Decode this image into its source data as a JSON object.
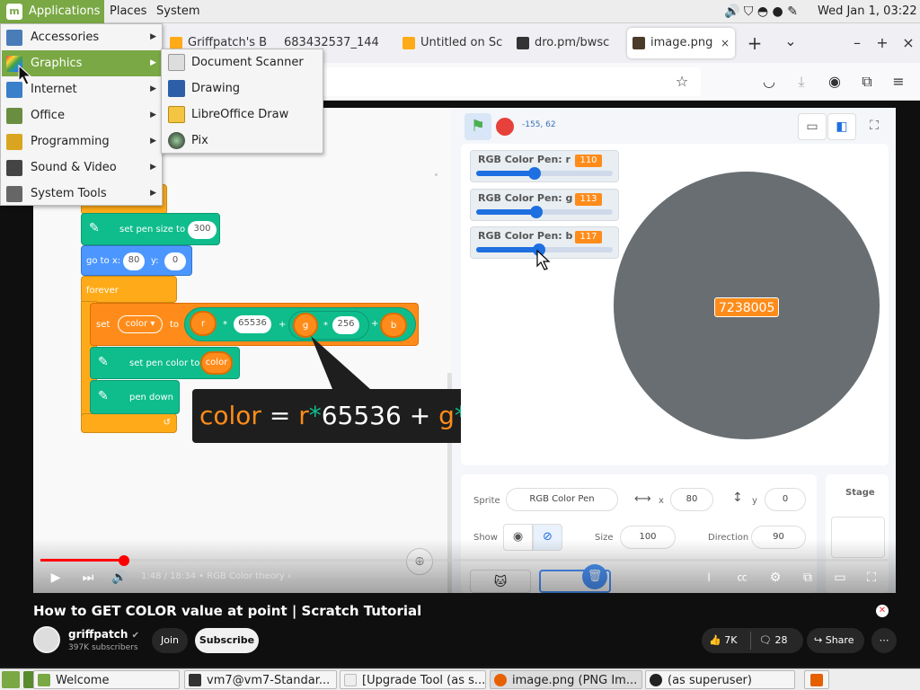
{
  "topbar": {
    "applications": "Applications",
    "places": "Places",
    "system": "System",
    "clock": "Wed Jan  1, 03:22"
  },
  "app_menu": {
    "items": [
      {
        "label": "Accessories",
        "icon": "accessories-icon",
        "color": "#4a7cb8"
      },
      {
        "label": "Graphics",
        "icon": "graphics-icon",
        "color": "#e05a2b",
        "highlighted": true
      },
      {
        "label": "Internet",
        "icon": "internet-icon",
        "color": "#3a7fc9"
      },
      {
        "label": "Office",
        "icon": "office-icon",
        "color": "#6a8e3f"
      },
      {
        "label": "Programming",
        "icon": "programming-icon",
        "color": "#d9a520"
      },
      {
        "label": "Sound & Video",
        "icon": "sound-video-icon",
        "color": "#444444"
      },
      {
        "label": "System Tools",
        "icon": "system-tools-icon",
        "color": "#666666"
      }
    ],
    "graphics_submenu": [
      {
        "label": "Document Scanner",
        "icon": "document-scanner-icon"
      },
      {
        "label": "Drawing",
        "icon": "drawing-icon"
      },
      {
        "label": "LibreOffice Draw",
        "icon": "libreoffice-draw-icon"
      },
      {
        "label": "Pix",
        "icon": "pix-icon"
      }
    ]
  },
  "browser": {
    "tabs": [
      {
        "label": "Griffpatch's B",
        "icon": "tab-favicon",
        "active": false
      },
      {
        "label": "683432537_144",
        "icon": "tab-favicon",
        "active": false
      },
      {
        "label": "Untitled on Sc",
        "icon": "tab-favicon",
        "active": false
      },
      {
        "label": "dro.pm/bwsc",
        "icon": "tab-favicon",
        "active": false
      },
      {
        "label": "image.png",
        "icon": "tab-favicon",
        "active": true
      }
    ],
    "new_tab": "+",
    "tab_list": "⌄",
    "window_minimize": "–",
    "window_maximize": "+",
    "window_close": "×"
  },
  "scratch": {
    "coords": "-155, 62",
    "blocks": {
      "set_pen_size_label": "set pen size to",
      "set_pen_size_value": "300",
      "goto_label": "go to x:",
      "goto_x": "80",
      "goto_y_label": "y:",
      "goto_y": "0",
      "forever": "forever",
      "set_label": "set",
      "var_name": "color",
      "to_label": "to",
      "r": "r",
      "mult1": "*",
      "val_65536": "65536",
      "plus1": "+",
      "g": "g",
      "mult2": "*",
      "val_256": "256",
      "plus2": "+",
      "b": "b",
      "set_pen_color_label": "set pen color to",
      "pen_color_value": "color",
      "pen_down": "pen down"
    },
    "callout": {
      "text_color": "color",
      "eq": " = ",
      "r": "r",
      "star1": "*",
      "n1": "65536",
      "plus1": " + ",
      "g": "g",
      "star2": "*",
      "n2": "256",
      "plus2": " + ",
      "b": "b"
    },
    "monitors": [
      {
        "label": "RGB Color Pen: r",
        "value": "110",
        "level": 0.43
      },
      {
        "label": "RGB Color Pen: g",
        "value": "113",
        "level": 0.44
      },
      {
        "label": "RGB Color Pen: b",
        "value": "117",
        "level": 0.46
      }
    ],
    "circle_value": "7238005",
    "circle_color": "#686e72",
    "sprite_pane": {
      "sprite_label": "Sprite",
      "sprite_name": "RGB Color Pen",
      "x_label": "x",
      "x_value": "80",
      "y_label": "y",
      "y_value": "0",
      "show_label": "Show",
      "size_label": "Size",
      "size_value": "100",
      "direction_label": "Direction",
      "direction_value": "90",
      "stage_label": "Stage"
    }
  },
  "player": {
    "time": "1:48 / 18:34  •  RGB Color theory  ›",
    "progress": 0.098
  },
  "video_meta": {
    "title": "How to GET COLOR value at point | Scratch Tutorial",
    "channel": "griffpatch",
    "subscribers": "397K subscribers",
    "join": "Join",
    "subscribe": "Subscribe",
    "likes": "7K",
    "comments": "28",
    "share": "Share",
    "more": "⋯"
  },
  "taskbar": {
    "items": [
      {
        "label": "Welcome",
        "icon": "mint-welcome-icon"
      },
      {
        "label": "vm7@vm7-Standar...",
        "icon": "terminal-icon"
      },
      {
        "label": "[Upgrade Tool (as s...",
        "icon": "upgrade-tool-icon"
      },
      {
        "label": "image.png (PNG Im...",
        "icon": "firefox-icon"
      },
      {
        "label": "(as superuser)",
        "icon": "superuser-icon"
      }
    ]
  },
  "colors": {
    "mint_green": "#7aa844",
    "scratch_orange": "#ff8c1a",
    "pen_green": "#0fbd8c",
    "motion_blue": "#4c97ff",
    "youtube_red": "#ff0000"
  }
}
